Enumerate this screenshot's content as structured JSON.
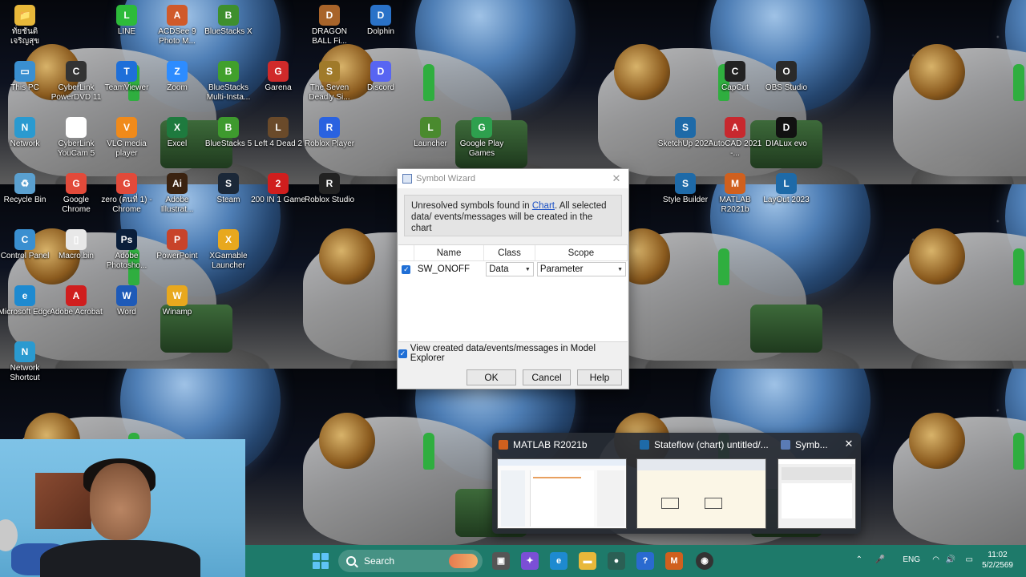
{
  "desktop_icons": [
    {
      "label": "ทั่ยชันดิ เจริญสุข",
      "glyph": "📁",
      "color": "#e8b83a"
    },
    {
      "label": "LINE",
      "glyph": "L",
      "color": "#2dbb3a"
    },
    {
      "label": "ACDSee 9 Photo M...",
      "glyph": "A",
      "color": "#d05a2a"
    },
    {
      "label": "BlueStacks X",
      "glyph": "B",
      "color": "#3e8f2e"
    },
    {
      "label": "DRAGON BALL Fi...",
      "glyph": "D",
      "color": "#a8642a"
    },
    {
      "label": "Dolphin",
      "glyph": "D",
      "color": "#2a72c8"
    },
    {
      "label": "This PC",
      "glyph": "▭",
      "color": "#3a8fd0"
    },
    {
      "label": "CyberLink PowerDVD 11",
      "glyph": "C",
      "color": "#333333"
    },
    {
      "label": "TeamViewer",
      "glyph": "T",
      "color": "#1e6fd9"
    },
    {
      "label": "Zoom",
      "glyph": "Z",
      "color": "#2d8cff"
    },
    {
      "label": "BlueStacks Multi-Insta...",
      "glyph": "B",
      "color": "#41a02c"
    },
    {
      "label": "Garena",
      "glyph": "G",
      "color": "#d02a2a"
    },
    {
      "label": "The Seven Deadly Si...",
      "glyph": "S",
      "color": "#a07a2a"
    },
    {
      "label": "Discord",
      "glyph": "D",
      "color": "#5865f2"
    },
    {
      "label": "CapCut",
      "glyph": "C",
      "color": "#222222"
    },
    {
      "label": "OBS Studio",
      "glyph": "O",
      "color": "#2a2a2a"
    },
    {
      "label": "Network",
      "glyph": "N",
      "color": "#2a9ad0"
    },
    {
      "label": "CyberLink YouCam 5",
      "glyph": "Y",
      "color": "#ffffff"
    },
    {
      "label": "VLC media player",
      "glyph": "V",
      "color": "#f08a1a"
    },
    {
      "label": "Excel",
      "glyph": "X",
      "color": "#1e7a3e"
    },
    {
      "label": "BlueStacks 5",
      "glyph": "B",
      "color": "#3e9a2e"
    },
    {
      "label": "Left 4 Dead 2",
      "glyph": "L",
      "color": "#6a4a2a"
    },
    {
      "label": "Roblox Player",
      "glyph": "R",
      "color": "#2a62e0"
    },
    {
      "label": "Launcher",
      "glyph": "L",
      "color": "#4a8a2e"
    },
    {
      "label": "Google Play Games",
      "glyph": "G",
      "color": "#2ea04e"
    },
    {
      "label": "SketchUp 2023",
      "glyph": "S",
      "color": "#1e6aa8"
    },
    {
      "label": "AutoCAD 2021 -...",
      "glyph": "A",
      "color": "#c8282e"
    },
    {
      "label": "DIALux evo",
      "glyph": "D",
      "color": "#111111"
    },
    {
      "label": "Recycle Bin",
      "glyph": "♻",
      "color": "#5aa0d0"
    },
    {
      "label": "Google Chrome",
      "glyph": "G",
      "color": "#e24a3a"
    },
    {
      "label": "zero (ตนที่ 1) - Chrome",
      "glyph": "G",
      "color": "#e24a3a"
    },
    {
      "label": "Adobe Illustrat...",
      "glyph": "Ai",
      "color": "#3a2210"
    },
    {
      "label": "Steam",
      "glyph": "S",
      "color": "#1b2838"
    },
    {
      "label": "200 IN 1 Game",
      "glyph": "2",
      "color": "#d01e1e"
    },
    {
      "label": "Roblox Studio",
      "glyph": "R",
      "color": "#222222"
    },
    {
      "label": "Style Builder",
      "glyph": "S",
      "color": "#1e6aa8"
    },
    {
      "label": "MATLAB R2021b",
      "glyph": "M",
      "color": "#d0601e"
    },
    {
      "label": "LayOut 2023",
      "glyph": "L",
      "color": "#1e6aa8"
    },
    {
      "label": "Control Panel",
      "glyph": "C",
      "color": "#3a8fd0"
    },
    {
      "label": "Macro.bin",
      "glyph": "▯",
      "color": "#e8e8e8"
    },
    {
      "label": "Adobe Photosho...",
      "glyph": "Ps",
      "color": "#0a1e3a"
    },
    {
      "label": "PowerPoint",
      "glyph": "P",
      "color": "#c8432a"
    },
    {
      "label": "XGamable Launcher",
      "glyph": "X",
      "color": "#e8a81e"
    },
    {
      "label": "Microsoft Edge",
      "glyph": "e",
      "color": "#1e8ad0"
    },
    {
      "label": "Adobe Acrobat",
      "glyph": "A",
      "color": "#d01e1e"
    },
    {
      "label": "Word",
      "glyph": "W",
      "color": "#1e5ab8"
    },
    {
      "label": "Winamp",
      "glyph": "W",
      "color": "#e8a81e"
    },
    {
      "label": "Network Shortcut",
      "glyph": "N",
      "color": "#2a9ad0"
    }
  ],
  "dialog": {
    "title": "Symbol Wizard",
    "close": "✕",
    "message_before": "Unresolved symbols found in ",
    "message_link": "Chart",
    "message_after": ". All selected data/ events/messages will be created in the chart",
    "columns": {
      "name": "Name",
      "class": "Class",
      "scope": "Scope"
    },
    "rows": [
      {
        "checked": true,
        "name": "SW_ONOFF",
        "class": "Data",
        "scope": "Parameter"
      }
    ],
    "view_option": "View created data/events/messages in Model Explorer",
    "buttons": {
      "ok": "OK",
      "cancel": "Cancel",
      "help": "Help"
    }
  },
  "taskbar_preview": {
    "items": [
      {
        "title": "MATLAB R2021b",
        "icon_color": "#d0601e"
      },
      {
        "title": "Stateflow (chart) untitled/...",
        "icon_color": "#1e6aa8"
      },
      {
        "title": "Symb...",
        "icon_color": "#5a7bb5"
      }
    ],
    "close": "✕"
  },
  "taskbar": {
    "search_placeholder": "Search",
    "tray": {
      "language": "ENG",
      "up_arrow": "⌃",
      "mic": "🎤",
      "wifi": "◠",
      "volume": "🔊",
      "battery": "▭"
    },
    "time": "11:02",
    "date": "5/2/2569"
  }
}
